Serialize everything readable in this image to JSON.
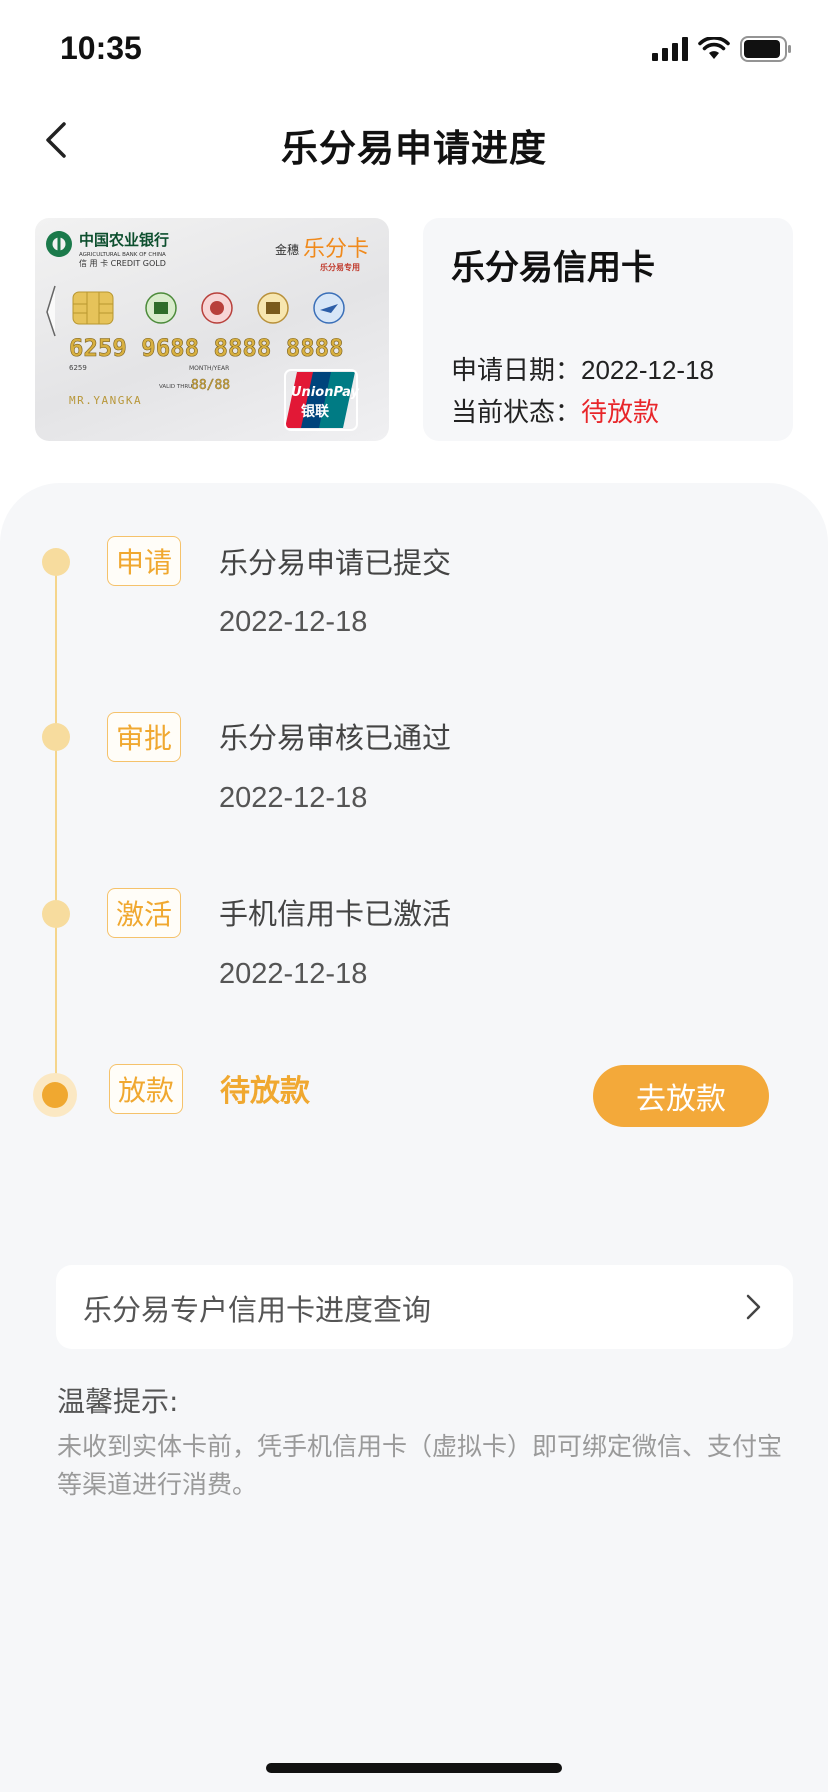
{
  "status_bar": {
    "time": "10:35"
  },
  "nav": {
    "title": "乐分易申请进度"
  },
  "card_art": {
    "bank_name_cn": "中国农业银行",
    "bank_name_en": "AGRICULTURAL BANK OF CHINA",
    "card_kind": "信 用 卡  CREDIT GOLD",
    "brand_prefix": "金穗",
    "brand_name": "乐分卡",
    "brand_sub": "乐分易专用",
    "card_number": "6259 9688 8888 8888",
    "number_small": "6259",
    "month_year_label": "MONTH/YEAR",
    "valid_thru_label": "VALID THRU",
    "expiry": "88/88",
    "holder": "MR.YANGKA",
    "network_en": "UnionPay",
    "network_cn": "银联"
  },
  "info": {
    "title": "乐分易信用卡",
    "apply_date_label": "申请日期：",
    "apply_date": "2022-12-18",
    "status_label": "当前状态：",
    "status_value": "待放款"
  },
  "steps": [
    {
      "tag": "申请",
      "title": "乐分易申请已提交",
      "date": "2022-12-18"
    },
    {
      "tag": "审批",
      "title": "乐分易审核已通过",
      "date": "2022-12-18"
    },
    {
      "tag": "激活",
      "title": "手机信用卡已激活",
      "date": "2022-12-18"
    },
    {
      "tag": "放款",
      "title": "待放款",
      "action": "去放款"
    }
  ],
  "query": {
    "label": "乐分易专户信用卡进度查询"
  },
  "tips": {
    "title": "温馨提示:",
    "body": "未收到实体卡前，凭手机信用卡（虚拟卡）即可绑定微信、支付宝等渠道进行消费。"
  },
  "colors": {
    "accent": "#f0a830",
    "status_red": "#e8262a",
    "panel_bg": "#f6f7f9"
  }
}
